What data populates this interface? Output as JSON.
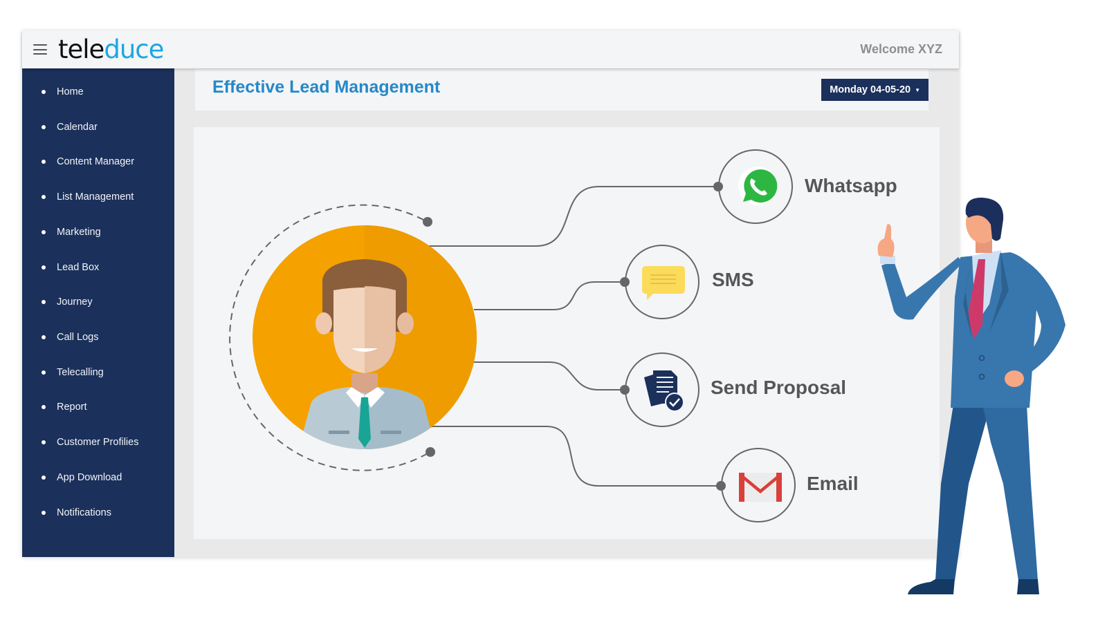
{
  "header": {
    "logo_part1": "tele",
    "logo_part2": "duce",
    "welcome": "Welcome XYZ"
  },
  "sidebar": {
    "items": [
      {
        "label": "Home"
      },
      {
        "label": "Calendar"
      },
      {
        "label": "Content Manager"
      },
      {
        "label": "List Management"
      },
      {
        "label": "Marketing"
      },
      {
        "label": "Lead Box"
      },
      {
        "label": "Journey"
      },
      {
        "label": "Call Logs"
      },
      {
        "label": "Telecalling"
      },
      {
        "label": "Report"
      },
      {
        "label": "Customer Profilies"
      },
      {
        "label": "App Download"
      },
      {
        "label": "Notifications"
      }
    ]
  },
  "main": {
    "title": "Effective Lead Management",
    "date_selector": "Monday 04-05-20",
    "channels": [
      {
        "label": "Whatsapp",
        "icon": "whatsapp-icon"
      },
      {
        "label": "SMS",
        "icon": "chat-bubble-icon"
      },
      {
        "label": "Send Proposal",
        "icon": "document-check-icon"
      },
      {
        "label": "Email",
        "icon": "gmail-icon"
      }
    ]
  },
  "colors": {
    "sidebar_bg": "#1b305b",
    "title_blue": "#2588c8",
    "logo_blue": "#1aa7e3",
    "avatar_orange": "#f5a100",
    "whatsapp_green": "#2db742",
    "sms_yellow": "#fcdb5a",
    "gmail_red": "#d9403a"
  }
}
